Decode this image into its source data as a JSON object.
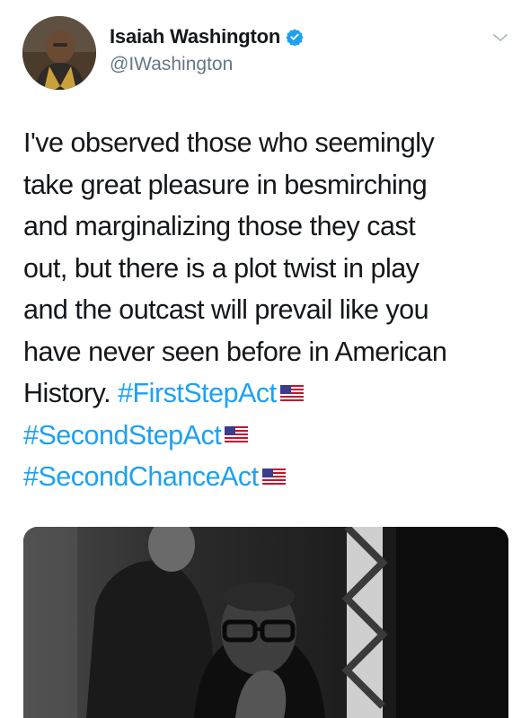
{
  "author": {
    "display_name": "Isaiah Washington",
    "handle": "@IWashington",
    "verified": true,
    "avatar_icon": "profile-photo"
  },
  "tweet": {
    "lines": [
      {
        "text": "I've observed those who seemingly"
      },
      {
        "text": "take great pleasure in besmirching"
      },
      {
        "text": "and marginalizing those they cast"
      },
      {
        "text": "out, but there is a plot twist in play"
      },
      {
        "text": "and the outcast will prevail like you"
      },
      {
        "text": "have never seen before in American"
      },
      {
        "text": "History.",
        "hashtag": "#FirstStepAct",
        "flag": "us-flag-emoji"
      }
    ],
    "hashtag_lines": [
      {
        "hashtag": "#SecondStepAct",
        "flag": "us-flag-emoji"
      },
      {
        "hashtag": "#SecondChanceAct",
        "flag": "us-flag-emoji"
      }
    ]
  },
  "colors": {
    "hashtag": "#1da1f2",
    "verified_badge": "#1da1f2",
    "text": "#14171a",
    "handle": "#657786"
  },
  "icons": {
    "chevron": "chevron-down-icon",
    "verified": "verified-badge-icon"
  }
}
